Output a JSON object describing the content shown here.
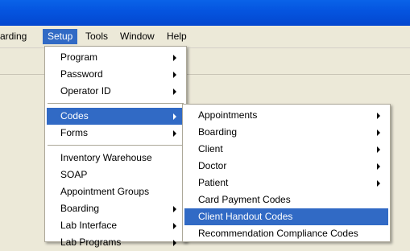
{
  "menubar": {
    "items": [
      "arding",
      "Setup",
      "Tools",
      "Window",
      "Help"
    ]
  },
  "setup_menu": {
    "items": [
      "Program",
      "Password",
      "Operator ID",
      "Codes",
      "Forms",
      "Inventory Warehouse",
      "SOAP",
      "Appointment Groups",
      "Boarding",
      "Lab Interface",
      "Lab Programs"
    ]
  },
  "codes_menu": {
    "items": [
      "Appointments",
      "Boarding",
      "Client",
      "Doctor",
      "Patient",
      "Card Payment Codes",
      "Client Handout Codes",
      "Recommendation Compliance Codes"
    ]
  },
  "colors": {
    "highlight": "#316ac5",
    "title_bar": "#0555e0",
    "menu_face": "#ece9d8"
  }
}
